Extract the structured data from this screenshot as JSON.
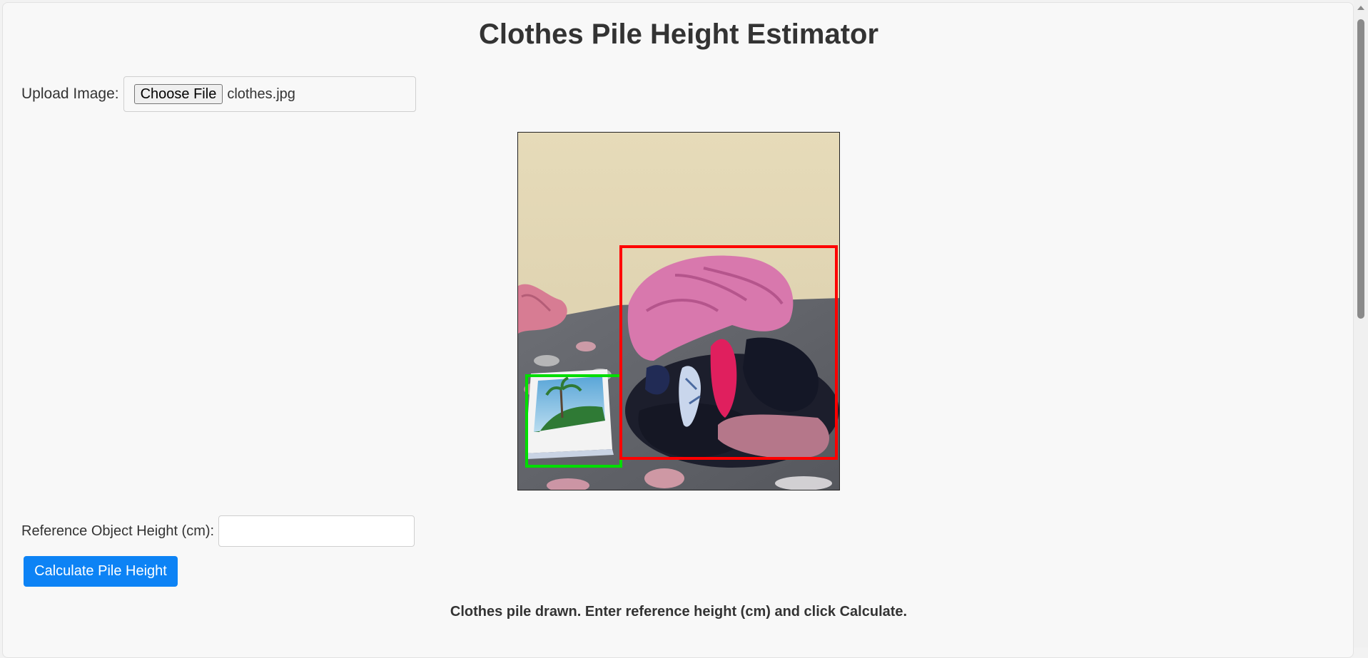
{
  "header": {
    "title": "Clothes Pile Height Estimator"
  },
  "upload": {
    "label": "Upload Image:",
    "button_label": "Choose File",
    "file_name": "clothes.jpg"
  },
  "canvas": {
    "image_description_icon": "clothes-photo",
    "reference_box_color": "#00dd00",
    "pile_box_color": "#ff0000"
  },
  "reference": {
    "label": "Reference Object Height (cm):",
    "value": "",
    "placeholder": ""
  },
  "actions": {
    "calculate_label": "Calculate Pile Height"
  },
  "status": {
    "message": "Clothes pile drawn. Enter reference height (cm) and click Calculate."
  },
  "colors": {
    "accent": "#0d83f5",
    "background": "#f8f8f8",
    "text": "#333333"
  }
}
